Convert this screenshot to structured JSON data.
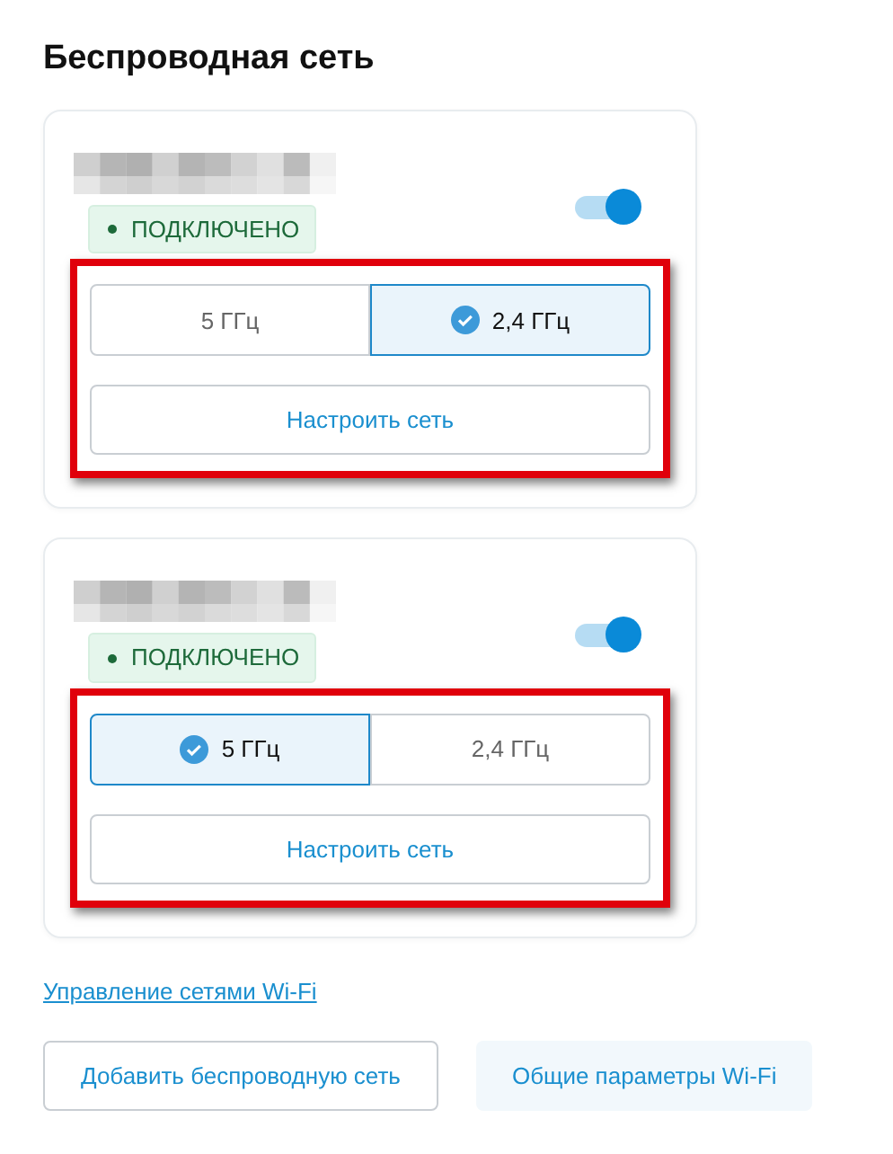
{
  "title": "Беспроводная сеть",
  "networks": [
    {
      "status": "ПОДКЛЮЧЕНО",
      "enabled": true,
      "highlighted": true,
      "bands": [
        {
          "label": "5 ГГц",
          "selected": false
        },
        {
          "label": "2,4 ГГц",
          "selected": true
        }
      ],
      "configure": "Настроить сеть"
    },
    {
      "status": "ПОДКЛЮЧЕНО",
      "enabled": true,
      "highlighted": true,
      "bands": [
        {
          "label": "5 ГГц",
          "selected": true
        },
        {
          "label": "2,4 ГГц",
          "selected": false
        }
      ],
      "configure": "Настроить сеть"
    }
  ],
  "manage_link": "Управление сетями Wi-Fi",
  "buttons": [
    {
      "label": "Добавить беспроводную сеть",
      "kind": "outline"
    },
    {
      "label": "Общие параметры Wi-Fi",
      "kind": "soft"
    }
  ]
}
